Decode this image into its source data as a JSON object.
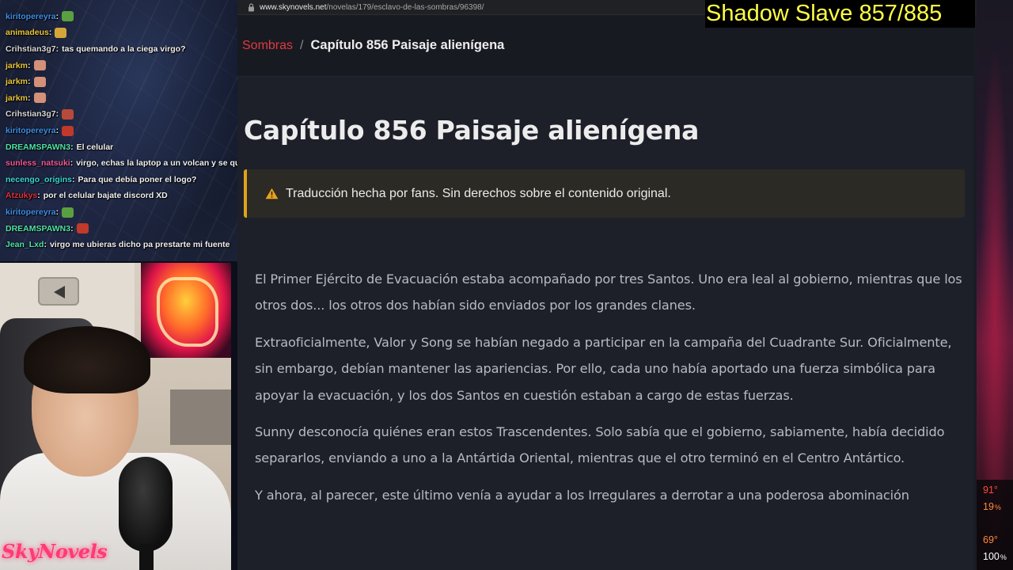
{
  "stream_title": "Shadow Slave 857/885",
  "chat": {
    "lines": [
      {
        "user": "",
        "user_color": "#8a6cff",
        "msg": "",
        "emote": ""
      },
      {
        "user": "kiritopereyra",
        "user_color": "#3c8fe6",
        "msg": "",
        "emote": "#5aa040"
      },
      {
        "user": "animadeus",
        "user_color": "#e8c63a",
        "msg": "",
        "emote": "#d4a63a"
      },
      {
        "user": "Crihstian3g7",
        "user_color": "#d8d8d8",
        "msg": "tas quemando a la ciega virgo?",
        "emote": ""
      },
      {
        "user": "jarkm",
        "user_color": "#e8c63a",
        "msg": "",
        "emote": "#d49078"
      },
      {
        "user": "jarkm",
        "user_color": "#e8c63a",
        "msg": "",
        "emote": "#d49078"
      },
      {
        "user": "jarkm",
        "user_color": "#e8c63a",
        "msg": "",
        "emote": "#d49078"
      },
      {
        "user": "Crihstian3g7",
        "user_color": "#d8d8d8",
        "msg": "",
        "emote": "#b84a3a"
      },
      {
        "user": "kiritopereyra",
        "user_color": "#3c8fe6",
        "msg": "",
        "emote": "#c0392b"
      },
      {
        "user": "DREAMSPAWN3",
        "user_color": "#4fe3a6",
        "msg": "El celular",
        "emote": ""
      },
      {
        "user": "sunless_natsuki",
        "user_color": "#f05a9a",
        "msg": "virgo, echas la laptop a un volcan y se qu",
        "emote": ""
      },
      {
        "user": "necengo_origins",
        "user_color": "#3ad6d6",
        "msg": "Para que debía poner el logo?",
        "emote": ""
      },
      {
        "user": "Atzukys",
        "user_color": "#e0303a",
        "msg": "por el celular bajate discord XD",
        "emote": ""
      },
      {
        "user": "kiritopereyra",
        "user_color": "#3c8fe6",
        "msg": "",
        "emote": "#5aa040"
      },
      {
        "user": "DREAMSPAWN3",
        "user_color": "#4fe3a6",
        "msg": "",
        "emote": "#c0392b"
      },
      {
        "user": "Jean_Lxd",
        "user_color": "#4fe3a6",
        "msg": "virgo me ubieras dicho pa prestarte mi fuente",
        "emote": ""
      }
    ]
  },
  "browser": {
    "url_domain": "www.skynovels.net",
    "url_path": "/novelas/179/esclavo-de-las-sombras/96398/",
    "breadcrumb": {
      "link": "Sombras",
      "separator": "/",
      "current": "Capítulo 856 Paisaje alienígena"
    },
    "chapter_title": "Capítulo 856 Paisaje alienígena",
    "notice": "Traducción hecha por fans. Sin derechos sobre el contenido original.",
    "paragraphs": [
      "El Primer Ejército de Evacuación estaba acompañado por tres Santos. Uno era leal al gobierno, mientras que los otros dos... los otros dos habían sido enviados por los grandes clanes.",
      "Extraoficialmente, Valor y Song se habían negado a participar en la campaña del Cuadrante Sur. Oficialmente, sin embargo, debían mantener las apariencias. Por ello, cada uno había aportado una fuerza simbólica para apoyar la evacuación, y los dos Santos en cuestión estaban a cargo de estas fuerzas.",
      "Sunny desconocía quiénes eran estos Trascendentes. Solo sabía que el gobierno, sabiamente, había decidido separarlos, enviando a uno a la Antártida Oriental, mientras que el otro terminó en el Centro Antártico.",
      "Y ahora, al parecer, este último venía a ayudar a los Irregulares a derrotar a una poderosa abominación"
    ]
  },
  "stats": {
    "temp1": "91°",
    "load1": "19",
    "load1_unit": "%",
    "temp2": "69°",
    "load2": "100",
    "load2_unit": "%"
  },
  "watermark": "SkyNovels",
  "colors": {
    "accent_red": "#e23a3f",
    "notice_border": "#e0a21c",
    "title_yellow": "#ffff44"
  }
}
